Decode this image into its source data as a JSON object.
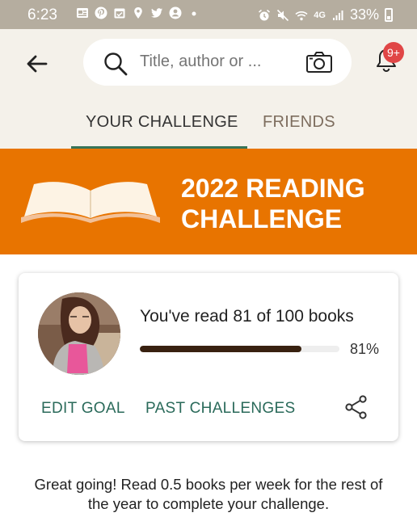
{
  "status_bar": {
    "time": "6:23",
    "network_label": "4G",
    "battery_percent": "33%",
    "icons": [
      "news-icon",
      "pinterest-icon",
      "calendar-icon",
      "location-icon",
      "twitter-icon",
      "account-icon",
      "dot-icon",
      "alarm-icon",
      "mute-icon",
      "wifi-icon",
      "signal-icon",
      "battery-icon"
    ]
  },
  "header": {
    "search_placeholder": "Title, author or ...",
    "notification_count": "9+"
  },
  "tabs": [
    {
      "label": "YOUR CHALLENGE",
      "active": true
    },
    {
      "label": "FRIENDS",
      "active": false
    }
  ],
  "banner": {
    "title": "2022 READING CHALLENGE"
  },
  "challenge_card": {
    "progress_text": "You've read 81 of 100 books",
    "books_read": 81,
    "books_goal": 100,
    "progress_fraction": 0.81,
    "percent_label": "81%",
    "edit_goal_label": "EDIT GOAL",
    "past_challenges_label": "PAST CHALLENGES"
  },
  "encouragement": {
    "line1": "Great going! Read 0.5 books per week for the rest of",
    "line2": "the year to complete your challenge."
  },
  "colors": {
    "status_bar": "#b5ad9f",
    "header_bg": "#f4f1ea",
    "banner_bg": "#e87400",
    "accent_green": "#377458",
    "link_green": "#2a6a5a",
    "progress_fill": "#382110",
    "badge_red": "#e04646"
  }
}
